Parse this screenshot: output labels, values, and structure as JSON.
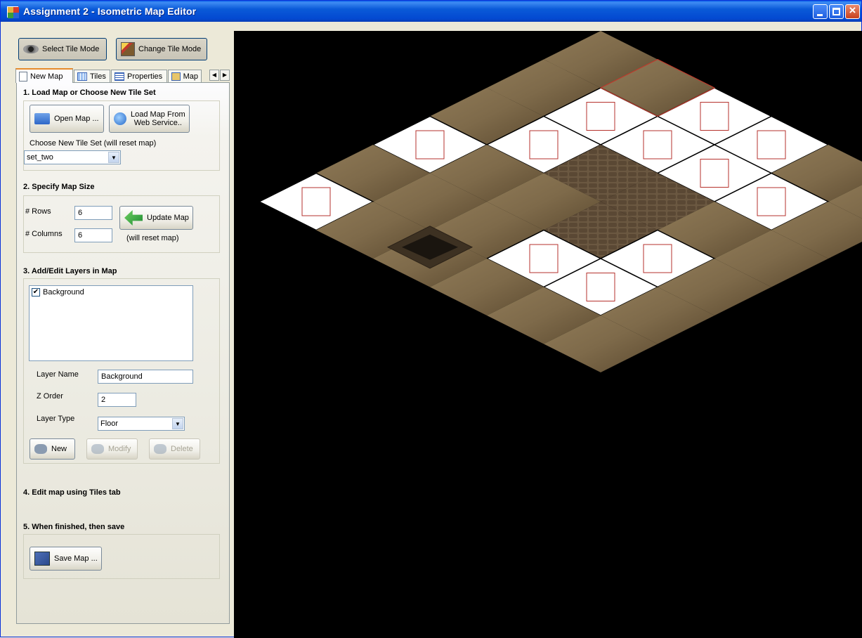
{
  "window": {
    "title": "Assignment 2 - Isometric Map Editor"
  },
  "toolbar": {
    "select_tile_mode": "Select Tile Mode",
    "change_tile_mode": "Change Tile Mode"
  },
  "tabs": [
    {
      "label": "New Map",
      "icon": "document-icon",
      "active": true
    },
    {
      "label": "Tiles",
      "icon": "tiles-icon",
      "active": false
    },
    {
      "label": "Properties",
      "icon": "properties-icon",
      "active": false
    },
    {
      "label": "Map",
      "icon": "map-icon",
      "active": false
    }
  ],
  "section1": {
    "title": "1. Load Map or Choose New Tile Set",
    "open_map": "Open Map ...",
    "load_web_line1": "Load Map From",
    "load_web_line2": "Web Service..",
    "tileset_label": "Choose New Tile Set (will reset map)",
    "tileset_value": "set_two"
  },
  "section2": {
    "title": "2. Specify Map Size",
    "rows_label": "# Rows",
    "rows_value": "6",
    "cols_label": "# Columns",
    "cols_value": "6",
    "update_button": "Update Map",
    "reset_note": "(will reset map)"
  },
  "section3": {
    "title": "3. Add/Edit Layers in Map",
    "layers": [
      {
        "name": "Background",
        "checked": true
      }
    ],
    "layer_name_label": "Layer Name",
    "layer_name_value": "Background",
    "z_order_label": "Z Order",
    "z_order_value": "2",
    "layer_type_label": "Layer Type",
    "layer_type_value": "Floor",
    "new_button": "New",
    "modify_button": "Modify",
    "delete_button": "Delete"
  },
  "section4": {
    "title": "4. Edit map using Tiles tab"
  },
  "section5": {
    "title": "5. When finished, then save",
    "save_button": "Save Map ..."
  },
  "map": {
    "rows": 6,
    "cols": 6,
    "background": "#000000",
    "ground_color": "#7e6a4a",
    "empty_tile_color": "#ffffff",
    "marker_color": "#b5312c",
    "empty_tiles": [
      [
        0,
        2
      ],
      [
        0,
        3
      ],
      [
        1,
        1
      ],
      [
        1,
        2
      ],
      [
        1,
        3
      ],
      [
        1,
        4
      ],
      [
        2,
        1
      ],
      [
        3,
        0
      ],
      [
        3,
        4
      ],
      [
        4,
        3
      ],
      [
        4,
        4
      ],
      [
        5,
        0
      ]
    ],
    "selected_tile": [
      0,
      1
    ],
    "cobble_tiles": [
      [
        2,
        3
      ],
      [
        3,
        3
      ],
      [
        2,
        2
      ]
    ],
    "well_tile": [
      0,
      0
    ]
  }
}
